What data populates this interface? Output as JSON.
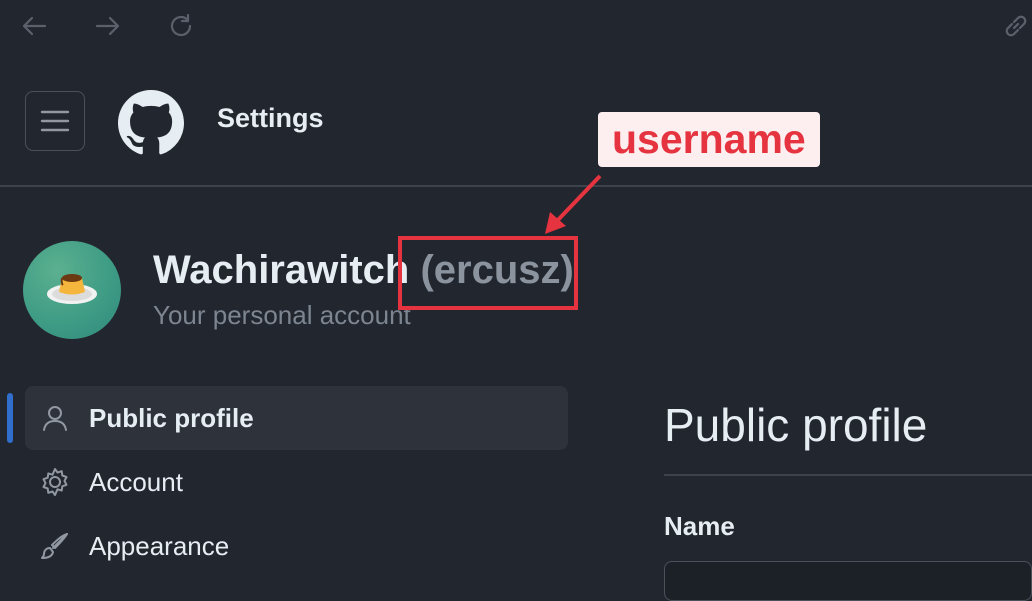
{
  "browser": {
    "back_icon": "arrow-left-icon",
    "forward_icon": "arrow-right-icon",
    "reload_icon": "reload-icon",
    "link_icon": "link-icon"
  },
  "header": {
    "title": "Settings",
    "menu_icon": "hamburger-icon",
    "logo_icon": "github-octocat-icon"
  },
  "annotation": {
    "label": "username",
    "color": "#e5343f"
  },
  "account": {
    "display_name": "Wachirawitch",
    "username": "(ercusz)",
    "subtitle": "Your personal account",
    "avatar_icon": "flan-pudding-avatar"
  },
  "sidebar": {
    "items": [
      {
        "label": "Public profile",
        "icon": "person-icon",
        "active": true
      },
      {
        "label": "Account",
        "icon": "gear-icon",
        "active": false
      },
      {
        "label": "Appearance",
        "icon": "paintbrush-icon",
        "active": false
      }
    ]
  },
  "main": {
    "title": "Public profile",
    "field_label": "Name",
    "field_value": ""
  },
  "colors": {
    "background": "#22262e",
    "accent": "#316dca",
    "annotation": "#e5343f"
  }
}
